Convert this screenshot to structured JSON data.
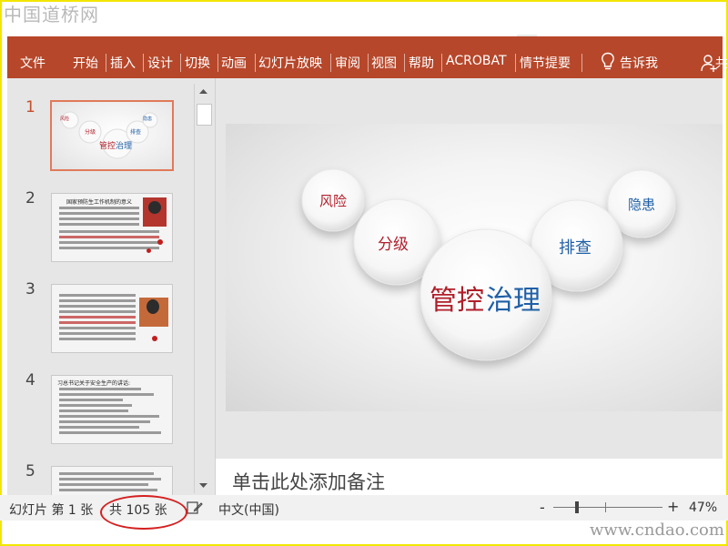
{
  "watermarks": {
    "top": "中国道桥网",
    "bottom": "www.cndao.com"
  },
  "ribbon": {
    "bg_color": "#b7472a",
    "items": [
      "文件",
      "开始",
      "插入",
      "设计",
      "切换",
      "动画",
      "幻灯片放映",
      "审阅",
      "视图",
      "帮助",
      "ACROBAT",
      "情节提要"
    ],
    "tell_me": "告诉我",
    "share": "共",
    "bulb_icon": "lightbulb-icon",
    "user_icon": "person-add-icon"
  },
  "slides": {
    "numbers": [
      "1",
      "2",
      "3",
      "4",
      "5"
    ],
    "thumb1": {
      "risk": "风险",
      "grade": "分级",
      "hidden": "隐患",
      "check": "排查",
      "title_a": "管控",
      "title_b": "治理"
    },
    "thumb2": {
      "title": "国家预防生工作机制的意义"
    },
    "thumb4": {
      "title": "习总书记关于安全生产的讲话:"
    }
  },
  "current_slide": {
    "bubbles": {
      "risk": "风险",
      "grade": "分级",
      "check": "排查",
      "hidden": "隐患"
    },
    "title_part1": "管控",
    "title_part2": "治理",
    "color_red": "#b01e2a",
    "color_blue": "#1f5fa6"
  },
  "notes": {
    "placeholder": "单击此处添加备注"
  },
  "status": {
    "slide_info": "幻灯片 第 1 张",
    "total": "共 105 张",
    "language": "中文(中国)",
    "zoom_minus": "-",
    "zoom_plus": "+",
    "zoom": "47%",
    "notes_icon": "notes-edit-icon"
  }
}
